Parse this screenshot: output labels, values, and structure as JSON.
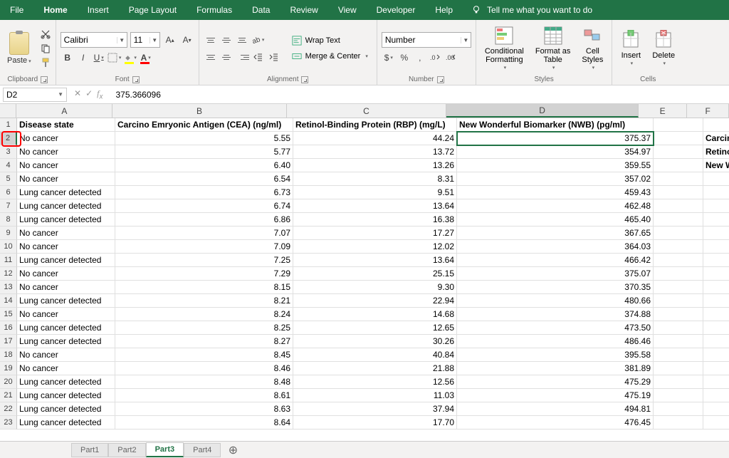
{
  "tabs": {
    "file": "File",
    "home": "Home",
    "insert": "Insert",
    "pagelayout": "Page Layout",
    "formulas": "Formulas",
    "data": "Data",
    "review": "Review",
    "view": "View",
    "developer": "Developer",
    "help": "Help",
    "tellme": "Tell me what you want to do"
  },
  "ribbon": {
    "clipboard": {
      "paste": "Paste",
      "label": "Clipboard"
    },
    "font": {
      "name": "Calibri",
      "size": "11",
      "label": "Font"
    },
    "alignment": {
      "wrap": "Wrap Text",
      "merge": "Merge & Center",
      "label": "Alignment"
    },
    "number": {
      "format": "Number",
      "label": "Number"
    },
    "styles": {
      "cond": "Conditional\nFormatting",
      "fmtTable": "Format as\nTable",
      "cellStyles": "Cell\nStyles",
      "label": "Styles"
    },
    "cells": {
      "insert": "Insert",
      "delete": "Delete",
      "label": "Cells"
    }
  },
  "formulabar": {
    "name": "D2",
    "value": "375.366096"
  },
  "columns": [
    "A",
    "B",
    "C",
    "D",
    "E",
    "F"
  ],
  "headers": {
    "A": "Disease state",
    "B": "Carcino Emryonic Antigen (CEA) (ng/ml)",
    "C": "Retinol-Binding Protein (RBP) (mg/L)",
    "D": "New Wonderful Biomarker (NWB) (pg/ml)",
    "F1": "Carcino E",
    "F2": "Retinol-B",
    "F3": "New Wo"
  },
  "rows": [
    {
      "r": 2,
      "a": "No cancer",
      "b": "5.55",
      "c": "44.24",
      "d": "375.37"
    },
    {
      "r": 3,
      "a": "No cancer",
      "b": "5.77",
      "c": "13.72",
      "d": "354.97"
    },
    {
      "r": 4,
      "a": "No cancer",
      "b": "6.40",
      "c": "13.26",
      "d": "359.55"
    },
    {
      "r": 5,
      "a": "No cancer",
      "b": "6.54",
      "c": "8.31",
      "d": "357.02"
    },
    {
      "r": 6,
      "a": "Lung cancer detected",
      "b": "6.73",
      "c": "9.51",
      "d": "459.43"
    },
    {
      "r": 7,
      "a": "Lung cancer detected",
      "b": "6.74",
      "c": "13.64",
      "d": "462.48"
    },
    {
      "r": 8,
      "a": "Lung cancer detected",
      "b": "6.86",
      "c": "16.38",
      "d": "465.40"
    },
    {
      "r": 9,
      "a": "No cancer",
      "b": "7.07",
      "c": "17.27",
      "d": "367.65"
    },
    {
      "r": 10,
      "a": "No cancer",
      "b": "7.09",
      "c": "12.02",
      "d": "364.03"
    },
    {
      "r": 11,
      "a": "Lung cancer detected",
      "b": "7.25",
      "c": "13.64",
      "d": "466.42"
    },
    {
      "r": 12,
      "a": "No cancer",
      "b": "7.29",
      "c": "25.15",
      "d": "375.07"
    },
    {
      "r": 13,
      "a": "No cancer",
      "b": "8.15",
      "c": "9.30",
      "d": "370.35"
    },
    {
      "r": 14,
      "a": "Lung cancer detected",
      "b": "8.21",
      "c": "22.94",
      "d": "480.66"
    },
    {
      "r": 15,
      "a": "No cancer",
      "b": "8.24",
      "c": "14.68",
      "d": "374.88"
    },
    {
      "r": 16,
      "a": "Lung cancer detected",
      "b": "8.25",
      "c": "12.65",
      "d": "473.50"
    },
    {
      "r": 17,
      "a": "Lung cancer detected",
      "b": "8.27",
      "c": "30.26",
      "d": "486.46"
    },
    {
      "r": 18,
      "a": "No cancer",
      "b": "8.45",
      "c": "40.84",
      "d": "395.58"
    },
    {
      "r": 19,
      "a": "No cancer",
      "b": "8.46",
      "c": "21.88",
      "d": "381.89"
    },
    {
      "r": 20,
      "a": "Lung cancer detected",
      "b": "8.48",
      "c": "12.56",
      "d": "475.29"
    },
    {
      "r": 21,
      "a": "Lung cancer detected",
      "b": "8.61",
      "c": "11.03",
      "d": "475.19"
    },
    {
      "r": 22,
      "a": "Lung cancer detected",
      "b": "8.63",
      "c": "37.94",
      "d": "494.81"
    },
    {
      "r": 23,
      "a": "Lung cancer detected",
      "b": "8.64",
      "c": "17.70",
      "d": "476.45"
    }
  ],
  "sheets": {
    "s1": "Part1",
    "s2": "Part2",
    "s3": "Part3",
    "s4": "Part4"
  },
  "selected": {
    "cell": "D2",
    "row": 2,
    "col": "D"
  }
}
